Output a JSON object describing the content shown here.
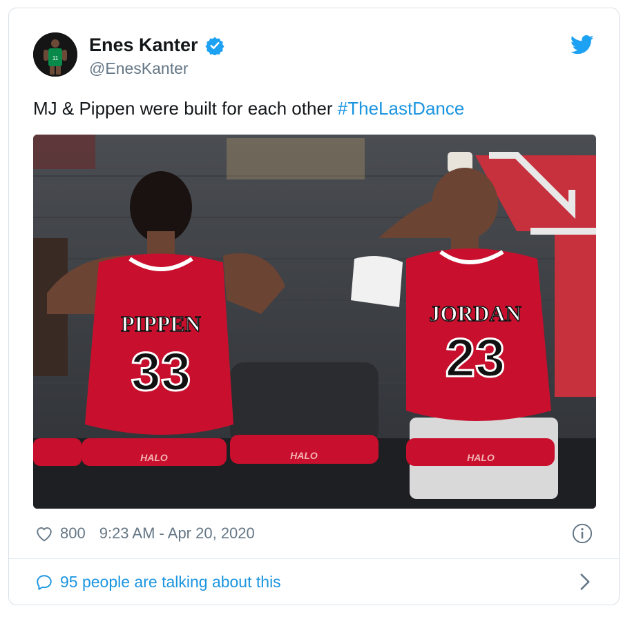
{
  "author": {
    "name": "Enes Kanter",
    "handle": "@EnesKanter",
    "avatar_jersey_number": "11"
  },
  "tweet": {
    "text": "MJ & Pippen were built for each other ",
    "hashtag": "#TheLastDance"
  },
  "photo": {
    "player_left_name": "PIPPEN",
    "player_left_number": "33",
    "player_right_name": "JORDAN",
    "player_right_number": "23",
    "chair_brand": "HALO"
  },
  "meta": {
    "likes": "800",
    "timestamp": "9:23 AM - Apr 20, 2020"
  },
  "footer": {
    "talking": "95 people are talking about this"
  },
  "colors": {
    "brand_blue": "#1b95e0",
    "verified_blue": "#1da1f2",
    "bulls_red": "#c8102e"
  }
}
